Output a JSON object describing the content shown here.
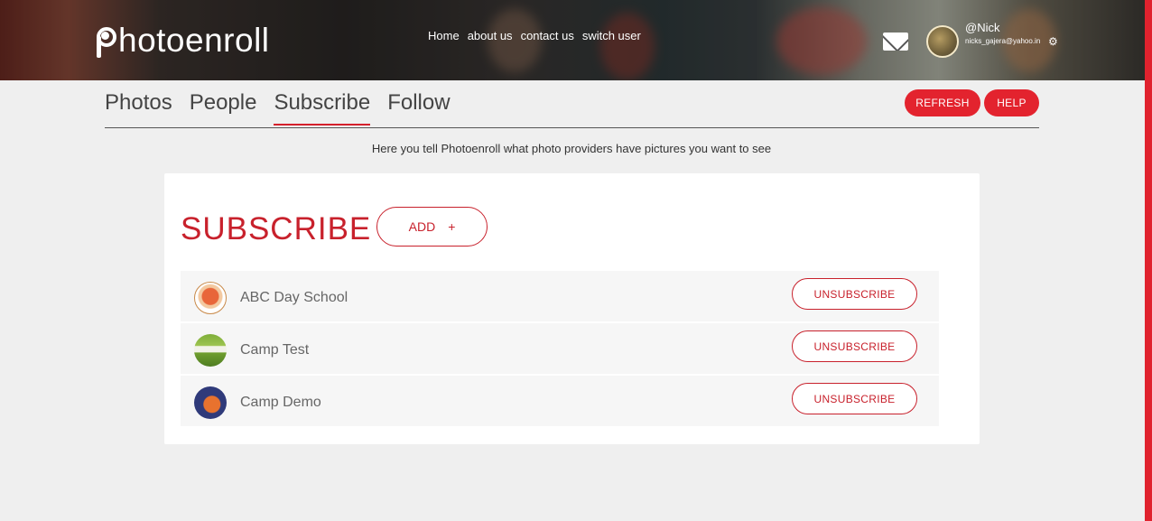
{
  "header": {
    "logo_text": "hotoenroll",
    "nav": [
      "Home",
      "about us",
      "contact us",
      "switch user"
    ],
    "user": {
      "name": "@Nick",
      "email": "nicks_gajera@yahoo.in"
    }
  },
  "tabs": {
    "items": [
      "Photos",
      "People",
      "Subscribe",
      "Follow"
    ],
    "active": "Subscribe",
    "refresh_label": "REFRESH",
    "help_label": "HELP"
  },
  "helptext": "Here you tell Photoenroll what photo providers have pictures you want to see",
  "subscribe": {
    "title": "SUBSCRIBE",
    "add_label": "ADD",
    "add_icon": "+",
    "unsubscribe_label": "UNSUBSCRIBE",
    "providers": [
      {
        "name": "ABC Day School",
        "icon": "abc-day-school-logo"
      },
      {
        "name": "Camp Test",
        "icon": "camp-test-logo"
      },
      {
        "name": "Camp Demo",
        "icon": "camp-demo-logo"
      }
    ]
  },
  "colors": {
    "accent": "#e3232e",
    "accent_dark": "#c8212c"
  }
}
